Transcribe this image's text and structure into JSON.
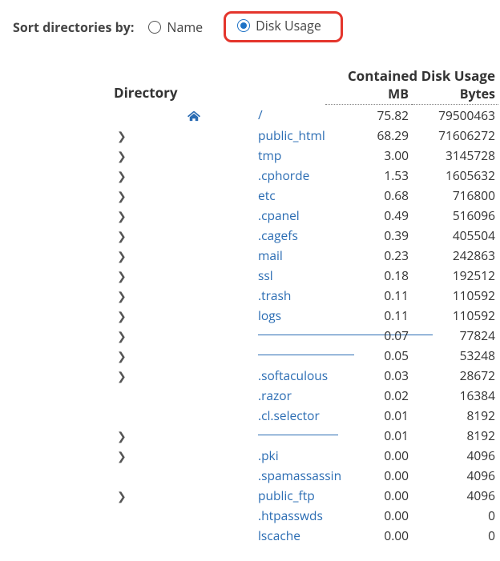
{
  "sort": {
    "label": "Sort directories by:",
    "option_name": "Name",
    "option_disk": "Disk Usage",
    "selected": "disk"
  },
  "headers": {
    "directory": "Directory",
    "contained": "Contained Disk Usage",
    "mb": "MB",
    "bytes": "Bytes"
  },
  "rows": [
    {
      "name": "/",
      "mb": "75.82",
      "bytes": "79500463",
      "expand": false,
      "home": true
    },
    {
      "name": "public_html",
      "mb": "68.29",
      "bytes": "71606272",
      "expand": true
    },
    {
      "name": "tmp",
      "mb": "3.00",
      "bytes": "3145728",
      "expand": true
    },
    {
      "name": ".cphorde",
      "mb": "1.53",
      "bytes": "1605632",
      "expand": true
    },
    {
      "name": "etc",
      "mb": "0.68",
      "bytes": "716800",
      "expand": true
    },
    {
      "name": ".cpanel",
      "mb": "0.49",
      "bytes": "516096",
      "expand": true
    },
    {
      "name": ".cagefs",
      "mb": "0.39",
      "bytes": "405504",
      "expand": true
    },
    {
      "name": "mail",
      "mb": "0.23",
      "bytes": "242863",
      "expand": true
    },
    {
      "name": "ssl",
      "mb": "0.18",
      "bytes": "192512",
      "expand": true
    },
    {
      "name": ".trash",
      "mb": "0.11",
      "bytes": "110592",
      "expand": true
    },
    {
      "name": "logs",
      "mb": "0.11",
      "bytes": "110592",
      "expand": true
    },
    {
      "name": "",
      "mb": "0.07",
      "bytes": "77824",
      "expand": true,
      "redacted": true,
      "redact_w": 218
    },
    {
      "name": "",
      "mb": "0.05",
      "bytes": "53248",
      "expand": true,
      "redacted": true,
      "redact_w": 120
    },
    {
      "name": ".softaculous",
      "mb": "0.03",
      "bytes": "28672",
      "expand": true
    },
    {
      "name": ".razor",
      "mb": "0.02",
      "bytes": "16384",
      "expand": false
    },
    {
      "name": ".cl.selector",
      "mb": "0.01",
      "bytes": "8192",
      "expand": false
    },
    {
      "name": "",
      "mb": "0.01",
      "bytes": "8192",
      "expand": true,
      "redacted": true,
      "redact_w": 100
    },
    {
      "name": ".pki",
      "mb": "0.00",
      "bytes": "4096",
      "expand": true
    },
    {
      "name": ".spamassassin",
      "mb": "0.00",
      "bytes": "4096",
      "expand": false
    },
    {
      "name": "public_ftp",
      "mb": "0.00",
      "bytes": "4096",
      "expand": true
    },
    {
      "name": ".htpasswds",
      "mb": "0.00",
      "bytes": "0",
      "expand": false
    },
    {
      "name": "lscache",
      "mb": "0.00",
      "bytes": "0",
      "expand": false
    }
  ]
}
